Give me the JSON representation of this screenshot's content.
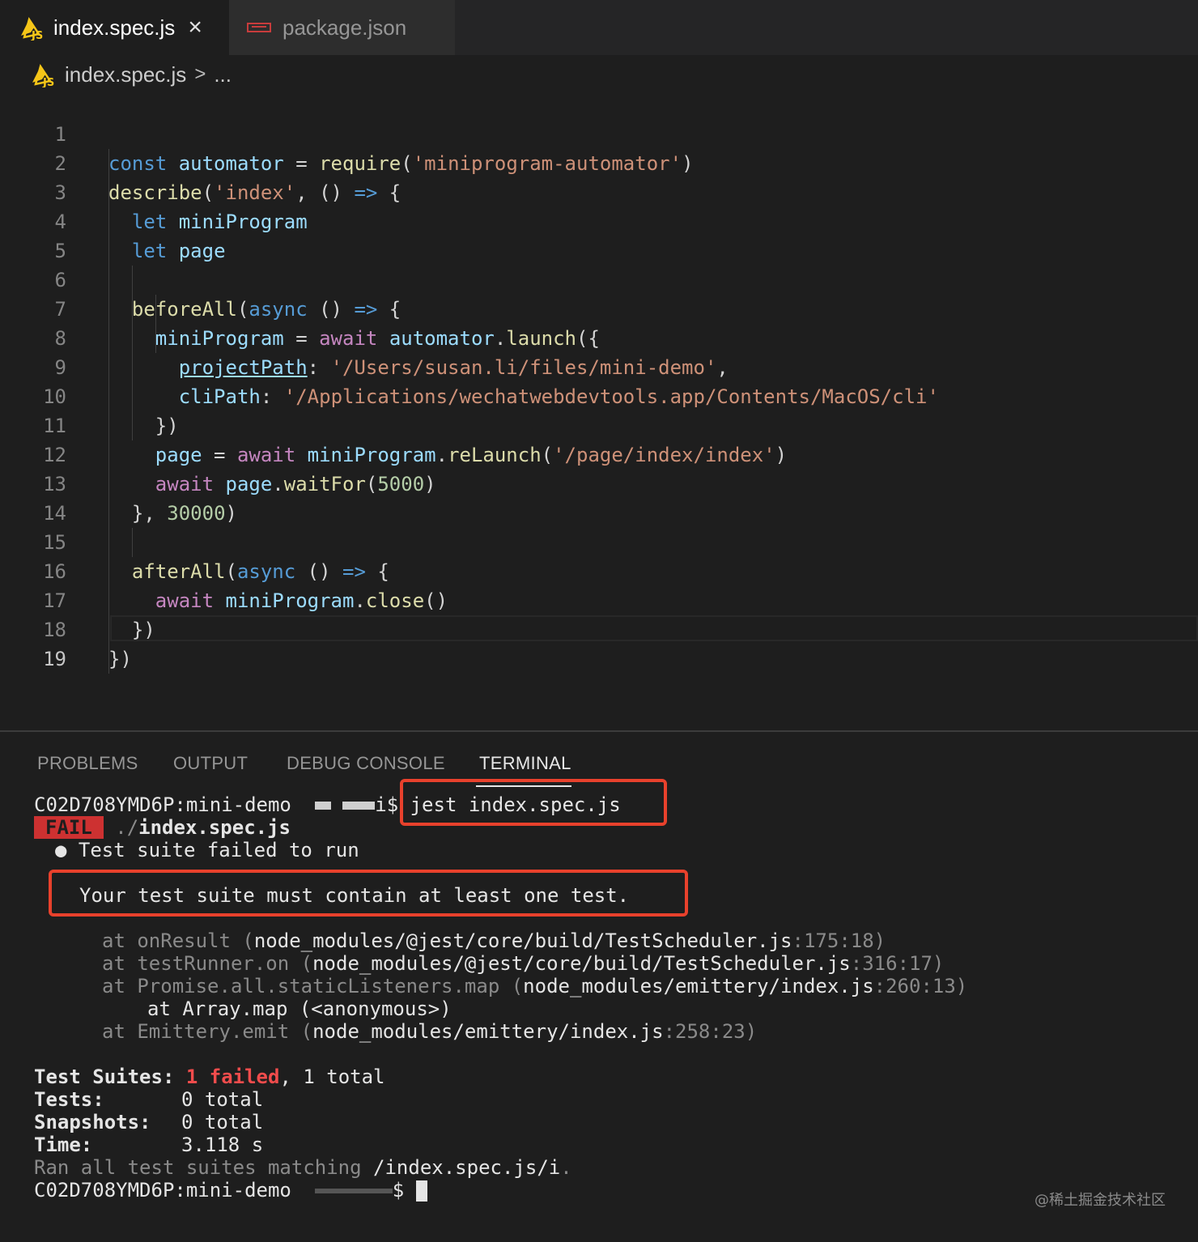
{
  "tabs": [
    {
      "label": "index.spec.js",
      "icon": "javascript-file-icon",
      "active": true
    },
    {
      "label": "package.json",
      "icon": "npm-icon",
      "active": false
    }
  ],
  "breadcrumb": {
    "file": "index.spec.js",
    "separator": ">",
    "more": "..."
  },
  "editor": {
    "line_numbers": [
      "1",
      "2",
      "3",
      "4",
      "5",
      "6",
      "7",
      "8",
      "9",
      "10",
      "11",
      "12",
      "13",
      "14",
      "15",
      "16",
      "17",
      "18",
      "19"
    ]
  },
  "panel": {
    "tabs": [
      "PROBLEMS",
      "OUTPUT",
      "DEBUG CONSOLE",
      "TERMINAL"
    ],
    "active_tab": "TERMINAL"
  },
  "terminal": {
    "prompt_host": "C02D708YMD6P:mini-demo",
    "prompt_suffix": "i$",
    "command": "jest index.spec.js",
    "fail_badge": "FAIL",
    "fail_file_prefix": "./",
    "fail_file": "index.spec.js",
    "bullet_message": "● Test suite failed to run",
    "error_message": "Your test suite must contain at least one test.",
    "stack": [
      {
        "prefix": "at onResult (",
        "path": "node_modules/@jest/core/build/TestScheduler.js",
        "pos": ":175:18)"
      },
      {
        "prefix": "at testRunner.on (",
        "path": "node_modules/@jest/core/build/TestScheduler.js",
        "pos": ":316:17)"
      },
      {
        "prefix": "at Promise.all.staticListeners.map (",
        "path": "node_modules/emittery/index.js",
        "pos": ":260:13)"
      },
      {
        "prefix": "",
        "path": "at Array.map (<anonymous>)",
        "pos": ""
      },
      {
        "prefix": "at Emittery.emit (",
        "path": "node_modules/emittery/index.js",
        "pos": ":258:23)"
      }
    ],
    "summary": {
      "suites_label": "Test Suites:",
      "suites_failed_count": "1",
      "suites_failed_word": "failed",
      "suites_rest": ", 1 total",
      "tests_label": "Tests:",
      "tests_value": "0 total",
      "snapshots_label": "Snapshots:",
      "snapshots_value": "0 total",
      "time_label": "Time:",
      "time_value": "3.118 s",
      "ran_prefix": "Ran all test suites matching",
      "ran_pattern": "/index.spec.js/i",
      "ran_suffix": "."
    },
    "final_prompt_suffix": "$"
  },
  "watermark": "@稀土掘金技术社区",
  "colors": {
    "fail_red": "#cd3131",
    "highlight_box": "#e8412c",
    "js_icon": "#f5c518"
  }
}
